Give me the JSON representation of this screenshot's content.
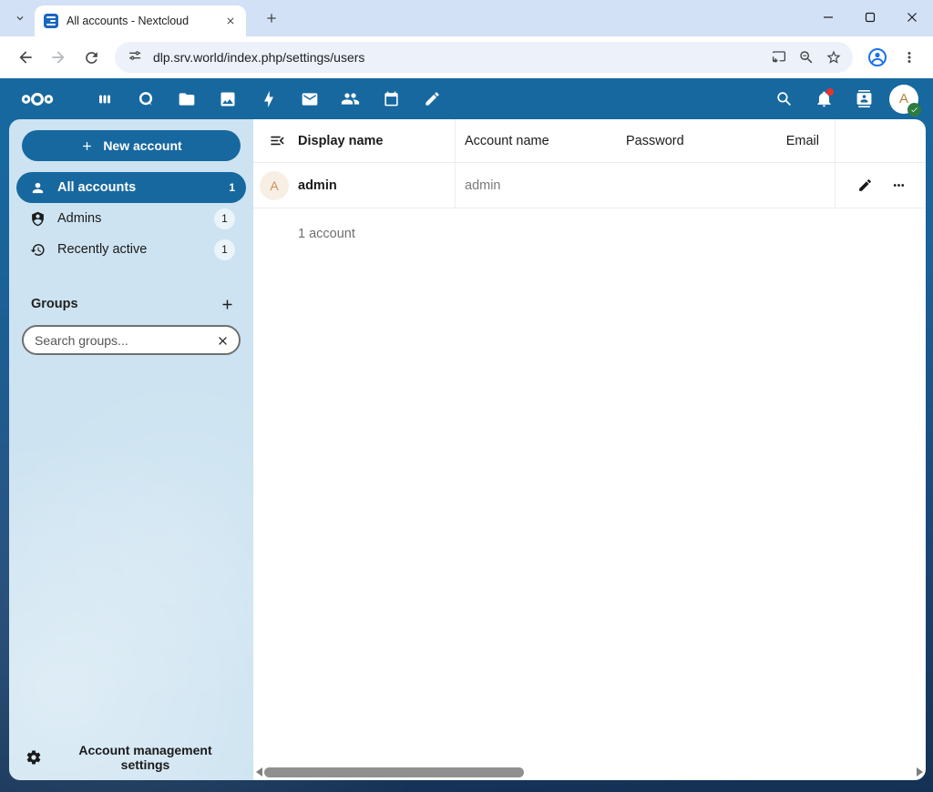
{
  "browser": {
    "tab_title": "All accounts - Nextcloud",
    "url": "dlp.srv.world/index.php/settings/users"
  },
  "header": {
    "avatar_letter": "A",
    "app_icons": [
      "nextcloud-logo",
      "dashboard",
      "talk",
      "files",
      "photos",
      "activity",
      "mail",
      "contacts",
      "calendar",
      "notes"
    ],
    "right_icons": [
      "search",
      "notifications",
      "contacts-menu",
      "avatar"
    ]
  },
  "sidebar": {
    "new_account_label": "New account",
    "items": [
      {
        "label": "All accounts",
        "count": "1",
        "selected": true
      },
      {
        "label": "Admins",
        "count": "1",
        "selected": false
      },
      {
        "label": "Recently active",
        "count": "1",
        "selected": false
      }
    ],
    "groups_label": "Groups",
    "search_placeholder": "Search groups...",
    "settings_label": "Account management settings"
  },
  "main": {
    "columns": [
      "Display name",
      "Account name",
      "Password",
      "Email"
    ],
    "row": {
      "avatar_letter": "A",
      "display_name": "admin",
      "account_name": "admin"
    },
    "summary": "1 account"
  },
  "colors": {
    "nextcloud_primary": "#17689f",
    "sidebar_bg": "#cde3f1",
    "page_bottom": "#143155",
    "notification_red": "#e9322d",
    "status_green": "#2d7b41",
    "avatar_bg": "#f8efe4",
    "avatar_letter": "#c4905e",
    "chrome_tabstrip": "#d3e1f7",
    "chrome_urlbar": "#edf1fa"
  }
}
